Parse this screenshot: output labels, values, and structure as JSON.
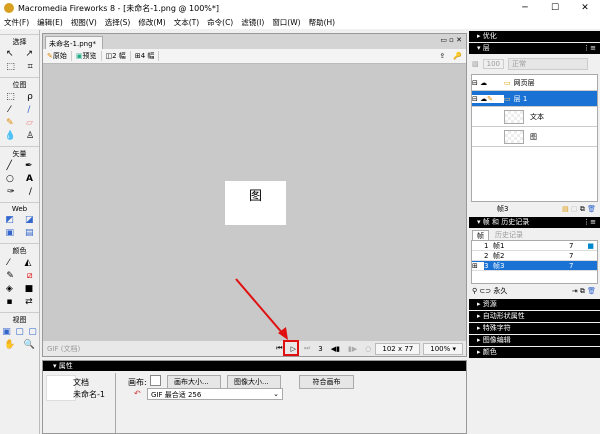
{
  "app": {
    "title": "Macromedia Fireworks 8 - [未命名-1.png @ 100%*]"
  },
  "menu": [
    "文件(F)",
    "编辑(E)",
    "视图(V)",
    "选择(S)",
    "修改(M)",
    "文本(T)",
    "命令(C)",
    "滤镜(I)",
    "窗口(W)",
    "帮助(H)"
  ],
  "tools": {
    "sections": [
      "选择",
      "位图",
      "矢量",
      "Web",
      "颜色",
      "视图"
    ]
  },
  "document": {
    "tab": "未命名-1.png*",
    "views": [
      "原始",
      "预览",
      "2 幅",
      "4 幅"
    ],
    "canvas_text": "图",
    "status": "GIF (文档)",
    "frame": "3",
    "size": "102 x 77",
    "zoom": "100%"
  },
  "properties": {
    "header": "属性",
    "doc_label": "文档",
    "doc_name": "未命名-1",
    "canvas_label": "画布:",
    "canvas_size_btn": "画布大小...",
    "image_size_btn": "图像大小...",
    "fit_btn": "符合画布",
    "export": "GIF 最合适 256"
  },
  "panels": {
    "optimize": "优化",
    "layers": {
      "title": "层",
      "opacity": "100",
      "blend": "正常",
      "rows": [
        "网页层",
        "层 1",
        "文本",
        "图"
      ],
      "frame_label": "帧3"
    },
    "frames": {
      "title": "帧 和 历史记录",
      "tabs": [
        "帧",
        "历史记录"
      ],
      "rows": [
        {
          "num": "1",
          "name": "帧1",
          "delay": "7"
        },
        {
          "num": "2",
          "name": "帧2",
          "delay": "7"
        },
        {
          "num": "3",
          "name": "帧3",
          "delay": "7"
        }
      ],
      "loop": "永久"
    },
    "collapsed": [
      "资源",
      "自动形状属性",
      "特殊字符",
      "图像编辑",
      "颜色"
    ]
  }
}
